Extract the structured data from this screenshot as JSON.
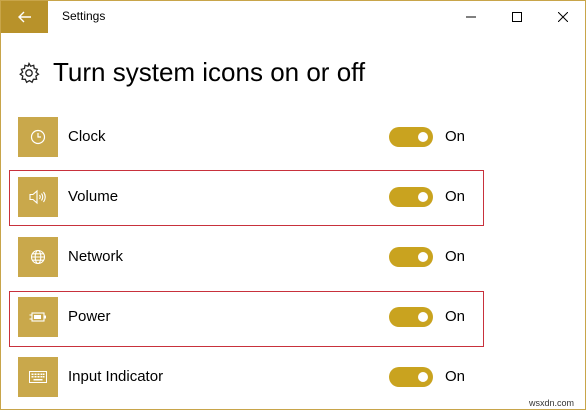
{
  "titlebar": {
    "title": "Settings",
    "back_icon": "back-arrow-icon",
    "accent": "#b8922a"
  },
  "header": {
    "icon": "gear-icon",
    "title": "Turn system icons on or off"
  },
  "items": [
    {
      "label": "Clock",
      "icon": "clock-icon",
      "state": "On",
      "on": true,
      "highlighted": false
    },
    {
      "label": "Volume",
      "icon": "volume-icon",
      "state": "On",
      "on": true,
      "highlighted": true
    },
    {
      "label": "Network",
      "icon": "network-icon",
      "state": "On",
      "on": true,
      "highlighted": false
    },
    {
      "label": "Power",
      "icon": "power-icon",
      "state": "On",
      "on": true,
      "highlighted": true
    },
    {
      "label": "Input Indicator",
      "icon": "keyboard-icon",
      "state": "On",
      "on": true,
      "highlighted": false
    }
  ],
  "colors": {
    "tile": "#c9a84b",
    "toggle_on": "#c9a31f",
    "highlight_border": "#c8313c"
  },
  "watermark": "wsxdn.com"
}
